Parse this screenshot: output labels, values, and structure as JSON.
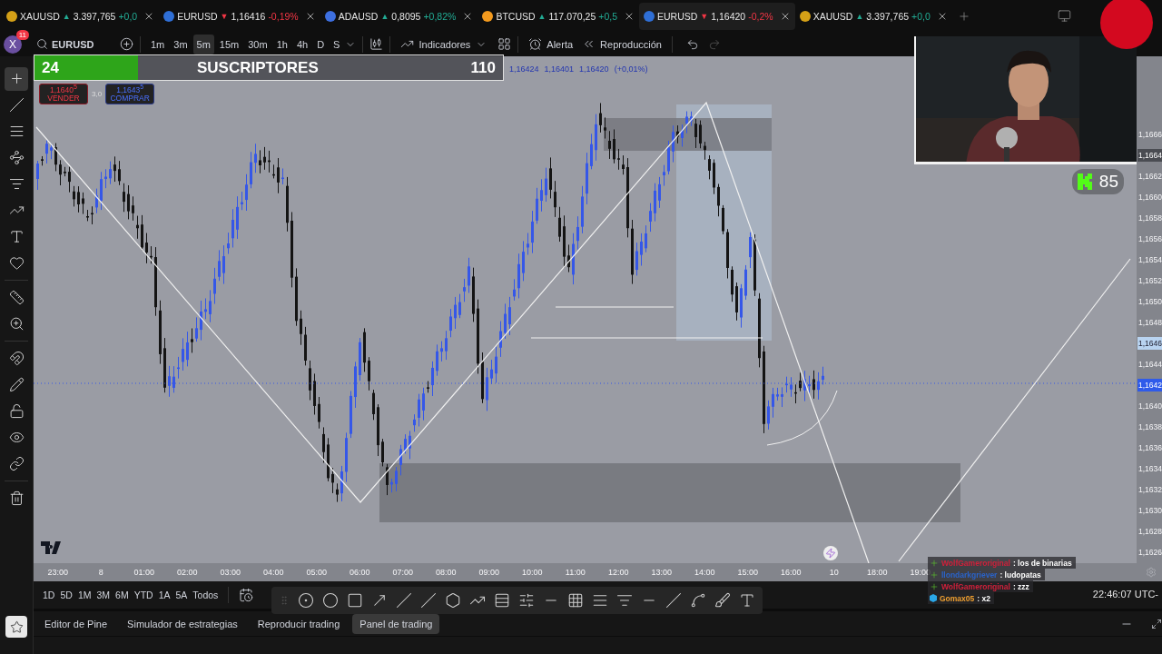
{
  "symbol_tabs": [
    {
      "symbol": "XAUUSD",
      "kind": "gain",
      "arrow": "▲",
      "price": "3.397,765",
      "change": "+0,0",
      "color": "#d4a017",
      "selected": false
    },
    {
      "symbol": "EURUSD",
      "kind": "loss",
      "arrow": "▼",
      "price": "1,16416",
      "change": "-0,19%",
      "color": "#2f6fd6",
      "selected": false
    },
    {
      "symbol": "ADAUSD",
      "kind": "gain",
      "arrow": "▲",
      "price": "0,8095",
      "change": "+0,82%",
      "color": "#3d6fe0",
      "selected": false
    },
    {
      "symbol": "BTCUSD",
      "kind": "gain",
      "arrow": "▲",
      "price": "117.070,25",
      "change": "+0,5",
      "color": "#f39a1e",
      "selected": false
    },
    {
      "symbol": "EURUSD",
      "kind": "loss",
      "arrow": "▼",
      "price": "1,16420",
      "change": "-0,2%",
      "color": "#2f6fd6",
      "selected": true
    },
    {
      "symbol": "XAUUSD",
      "kind": "gain",
      "arrow": "▲",
      "price": "3.397,765",
      "change": "+0,0",
      "color": "#d4a017",
      "selected": false
    }
  ],
  "toolbar": {
    "avatar": "X",
    "notifications": "11",
    "symbol": "EURUSD",
    "intervals": [
      {
        "label": "1m",
        "selected": false
      },
      {
        "label": "3m",
        "selected": false
      },
      {
        "label": "5m",
        "selected": true
      },
      {
        "label": "15m",
        "selected": false
      },
      {
        "label": "30m",
        "selected": false
      },
      {
        "label": "1h",
        "selected": false
      },
      {
        "label": "4h",
        "selected": false
      },
      {
        "label": "D",
        "selected": false
      },
      {
        "label": "S",
        "selected": false
      }
    ],
    "indicators": "Indicadores",
    "alert": "Alerta",
    "replay": "Reproducción"
  },
  "tool_groups": [
    [
      {
        "kind": "crosshair",
        "selected": true
      },
      {
        "kind": "trend-line",
        "selected": false
      },
      {
        "kind": "fib",
        "selected": false
      },
      {
        "kind": "pattern",
        "selected": false
      },
      {
        "kind": "forecast",
        "selected": false
      },
      {
        "kind": "path",
        "selected": false
      },
      {
        "kind": "text",
        "selected": false
      },
      {
        "kind": "heart",
        "selected": false
      }
    ],
    [
      {
        "kind": "ruler",
        "selected": false
      },
      {
        "kind": "zoom",
        "selected": false
      }
    ],
    [
      {
        "kind": "magnet",
        "selected": false
      },
      {
        "kind": "pencil",
        "selected": false
      },
      {
        "kind": "lock",
        "selected": false
      },
      {
        "kind": "eye",
        "selected": false
      },
      {
        "kind": "link",
        "selected": false
      }
    ],
    [
      {
        "kind": "trash",
        "selected": false
      }
    ]
  ],
  "subscriber_goal": {
    "current": "24",
    "label": "SUSCRIPTORES",
    "target": "110",
    "level": 0.22
  },
  "legend": [
    "1,16424",
    "1,16401",
    "1,16420",
    "(+0,01%)"
  ],
  "order_buttons": {
    "sell": {
      "price": "1,1640$^{5}$",
      "label": "VENDER"
    },
    "spread": "3,0",
    "buy": {
      "price": "1,1643$^{5}$",
      "label": "COMPRAR"
    }
  },
  "price_axis": [
    {
      "label": "1,1666",
      "kind": "plain"
    },
    {
      "label": "1,1664",
      "kind": "crosshair"
    },
    {
      "label": "1,1662",
      "kind": "plain"
    },
    {
      "label": "1,1660",
      "kind": "plain"
    },
    {
      "label": "1,1658",
      "kind": "plain"
    },
    {
      "label": "1,1656",
      "kind": "plain"
    },
    {
      "label": "1,1654",
      "kind": "plain"
    },
    {
      "label": "1,1652",
      "kind": "plain"
    },
    {
      "label": "1,1650",
      "kind": "plain"
    },
    {
      "label": "1,1648",
      "kind": "plain"
    },
    {
      "label": "1,1646",
      "kind": "marker"
    },
    {
      "label": "1,1644",
      "kind": "plain"
    },
    {
      "label": "1,1642",
      "kind": "last"
    },
    {
      "label": "1,1640",
      "kind": "plain"
    },
    {
      "label": "1,1638",
      "kind": "plain"
    },
    {
      "label": "1,1636",
      "kind": "plain"
    },
    {
      "label": "1,1634",
      "kind": "plain"
    },
    {
      "label": "1,1632",
      "kind": "plain"
    },
    {
      "label": "1,1630",
      "kind": "plain"
    },
    {
      "label": "1,1628",
      "kind": "plain"
    },
    {
      "label": "1,1626",
      "kind": "plain"
    }
  ],
  "time_axis": [
    "23:00",
    "8",
    "01:00",
    "02:00",
    "03:00",
    "04:00",
    "05:00",
    "06:00",
    "07:00",
    "08:00",
    "09:00",
    "10:00",
    "11:00",
    "12:00",
    "13:00",
    "14:00",
    "15:00",
    "16:00",
    "10",
    "18:00",
    "19:00"
  ],
  "counter_badge": {
    "value": "85"
  },
  "chat": [
    {
      "kind": "plus",
      "user": "WolfGameroriginal",
      "color": "#d0203a",
      "message": ": los de binarias"
    },
    {
      "kind": "plus",
      "user": "llondarkgriever",
      "color": "#2a63c9",
      "message": ": ludopatas"
    },
    {
      "kind": "plus",
      "user": "WolfGameroriginal",
      "color": "#d0203a",
      "message": ": zzz"
    },
    {
      "kind": "cube",
      "user": "Gomax05",
      "color": "#f0a030",
      "message": ": x2"
    }
  ],
  "range_buttons": [
    "1D",
    "5D",
    "1M",
    "3M",
    "6M",
    "YTD",
    "1A",
    "5A",
    "Todos"
  ],
  "clock": "22:46:07 UTC-",
  "bottom_tabs": [
    {
      "label": "Editor de Pine",
      "selected": false
    },
    {
      "label": "Simulador de estrategias",
      "selected": false
    },
    {
      "label": "Reproducir trading",
      "selected": false
    },
    {
      "label": "Panel de trading",
      "selected": true
    }
  ]
}
